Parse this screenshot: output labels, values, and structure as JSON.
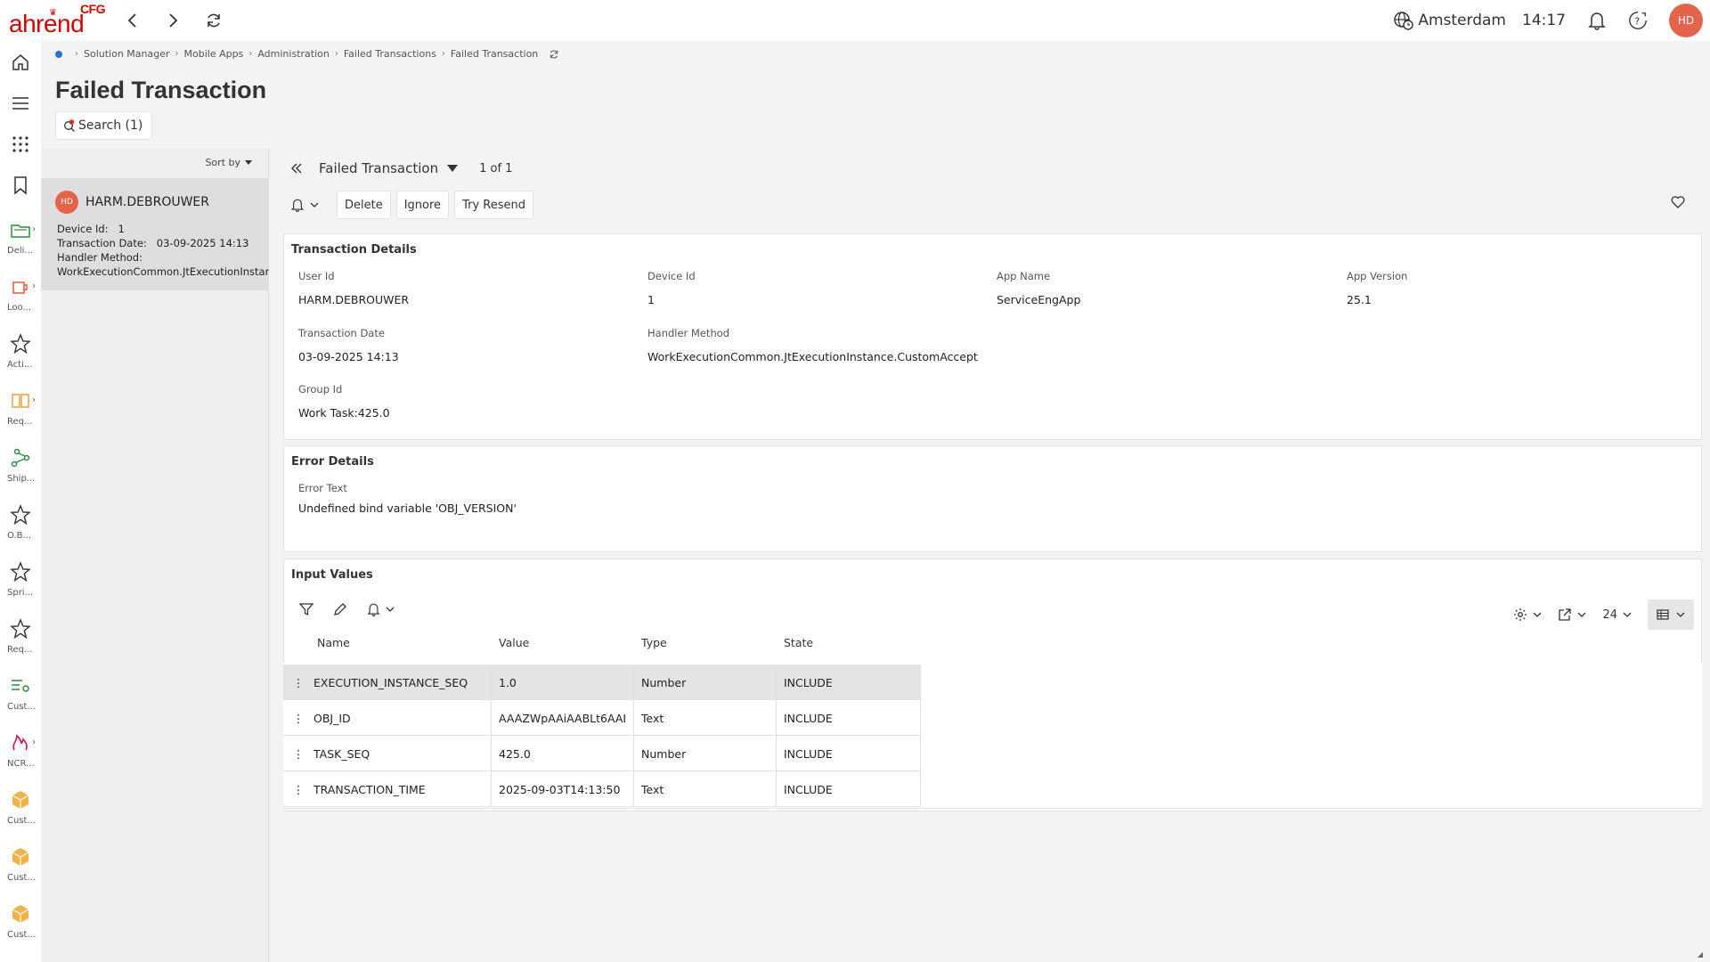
{
  "brand": {
    "cfg": "CFG",
    "name": "ahrend"
  },
  "topbar": {
    "location": "Amsterdam",
    "time": "14:17",
    "user_initials": "HD"
  },
  "rail": [
    {
      "label": "Deli..."
    },
    {
      "label": "Loo..."
    },
    {
      "label": "Acti..."
    },
    {
      "label": "Req..."
    },
    {
      "label": "Ship..."
    },
    {
      "label": "O.B..."
    },
    {
      "label": "Spri..."
    },
    {
      "label": "Req..."
    },
    {
      "label": "Cust..."
    },
    {
      "label": "NCR..."
    },
    {
      "label": "Cust..."
    },
    {
      "label": "Cust..."
    },
    {
      "label": "Cust..."
    }
  ],
  "breadcrumb": [
    "Solution Manager",
    "Mobile Apps",
    "Administration",
    "Failed Transactions",
    "Failed Transaction"
  ],
  "page_title": "Failed Transaction",
  "search_label": "Search (1)",
  "list": {
    "sort_label": "Sort by",
    "items": [
      {
        "initials": "HD",
        "name": "HARM.DEBROUWER",
        "device_label": "Device Id:",
        "device_value": "1",
        "date_label": "Transaction Date:",
        "date_value": "03-09-2025 14:13",
        "handler_label": "Handler Method:",
        "handler_value": "WorkExecutionCommon.JtExecutionInstance.C"
      }
    ]
  },
  "detail": {
    "title": "Failed Transaction",
    "count": "1 of 1",
    "actions": {
      "delete": "Delete",
      "ignore": "Ignore",
      "resend": "Try Resend"
    }
  },
  "transaction": {
    "title": "Transaction Details",
    "fields": [
      {
        "label": "User Id",
        "value": "HARM.DEBROUWER"
      },
      {
        "label": "Device Id",
        "value": "1"
      },
      {
        "label": "App Name",
        "value": "ServiceEngApp"
      },
      {
        "label": "App Version",
        "value": "25.1"
      },
      {
        "label": "Transaction Date",
        "value": "03-09-2025 14:13"
      },
      {
        "label": "Handler Method",
        "value": "WorkExecutionCommon.JtExecutionInstance.CustomAccept"
      },
      {
        "label": "Group Id",
        "value": "Work Task:425.0"
      }
    ]
  },
  "error": {
    "title": "Error Details",
    "label": "Error Text",
    "value": "Undefined bind variable 'OBJ_VERSION'"
  },
  "inputs": {
    "title": "Input Values",
    "page_size": "24",
    "columns": [
      "Name",
      "Value",
      "Type",
      "State"
    ],
    "rows": [
      {
        "name": "EXECUTION_INSTANCE_SEQ",
        "value": "1.0",
        "type": "Number",
        "state": "INCLUDE"
      },
      {
        "name": "OBJ_ID",
        "value": "AAAZWpAAiAABLt6AAI",
        "type": "Text",
        "state": "INCLUDE"
      },
      {
        "name": "TASK_SEQ",
        "value": "425.0",
        "type": "Number",
        "state": "INCLUDE"
      },
      {
        "name": "TRANSACTION_TIME",
        "value": "2025-09-03T14:13:50",
        "type": "Text",
        "state": "INCLUDE"
      }
    ]
  },
  "colors": {
    "brand_red": "#d10000",
    "avatar": "#e4644b",
    "accent_blue": "#2a6fd8",
    "selected_row": "#e4e4e4"
  }
}
